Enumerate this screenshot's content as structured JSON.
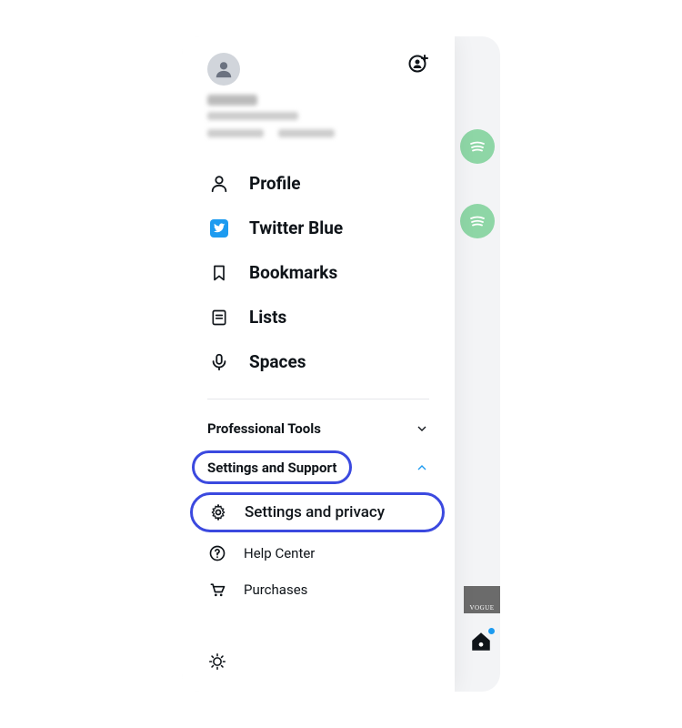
{
  "user": {
    "name": "User",
    "handle": "@user",
    "following": "Following",
    "followers": "Followers"
  },
  "nav": {
    "profile": "Profile",
    "twitter_blue": "Twitter Blue",
    "bookmarks": "Bookmarks",
    "lists": "Lists",
    "spaces": "Spaces"
  },
  "sections": {
    "professional_tools": "Professional Tools",
    "settings_support": "Settings and Support"
  },
  "submenu": {
    "settings_privacy": "Settings and privacy",
    "help_center": "Help Center",
    "purchases": "Purchases"
  },
  "bg": {
    "vogue": "VOGUE"
  },
  "colors": {
    "accent": "#1d9bf0",
    "highlight": "#3b49df"
  }
}
